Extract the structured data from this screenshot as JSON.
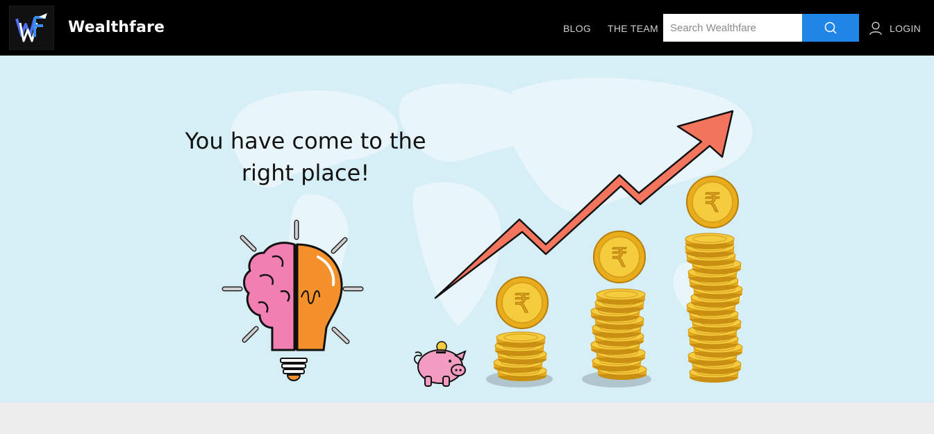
{
  "header": {
    "brand": "Wealthfare",
    "logo_text": "WF",
    "nav": [
      {
        "label": "BLOG"
      },
      {
        "label": "THE TEAM"
      }
    ],
    "search": {
      "placeholder": "Search Wealthfare",
      "button_icon": "search-icon"
    },
    "login": {
      "label": "LOGIN",
      "icon": "user-icon"
    }
  },
  "hero": {
    "headline": "You have come to the right place!",
    "illustrations": [
      "world-map",
      "brain-lightbulb",
      "piggy-bank",
      "rupee-coin-stacks",
      "rising-arrow"
    ],
    "currency_symbol": "₹"
  },
  "colors": {
    "navbar": "#000000",
    "search_button": "#1f86e8",
    "hero_background": "#d6eef6",
    "arrow": "#f4755e",
    "coin": "#f2c12e",
    "page_background": "#ededed"
  }
}
